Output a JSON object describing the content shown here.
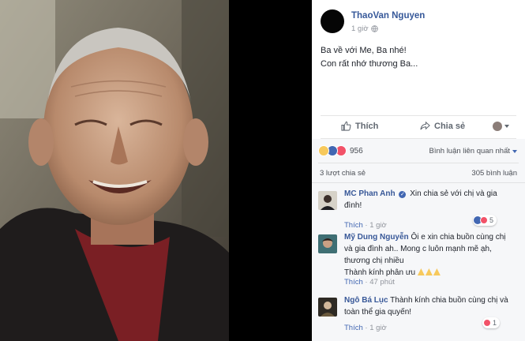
{
  "post": {
    "author": "ThaoVan Nguyen",
    "time": "1 giờ",
    "lines": [
      "Ba về với Me, Ba nhé!",
      "Con rất nhớ thương Ba..."
    ]
  },
  "actions": {
    "like": "Thích",
    "share": "Chia sẻ"
  },
  "summary": {
    "reaction_count": "956",
    "sort_label": "Bình luận liên quan nhất",
    "shares": "3 lượt chia sẻ",
    "comments": "305 bình luận"
  },
  "comments": [
    {
      "name": "MC Phan Anh",
      "verified": true,
      "text": "Xin chia sẻ với chị và gia đình!",
      "like": "Thích",
      "time": "1 giờ",
      "reactions": "5"
    },
    {
      "name": "Mỹ Dung Nguyễn",
      "text": "Ôi e xin chia buồn cùng chị và gia đình ah.. Mong c luôn mạnh mẽ ạh, thương chị nhiều",
      "text2": "Thành kính phân ưu",
      "like": "Thích",
      "time": "47 phút"
    },
    {
      "name": "Ngô Bá Lục",
      "text": "Thành kính chia buồn cùng chị và toàn thể gia quyến!",
      "like": "Thích",
      "time": "1 giờ",
      "reactions": "1"
    }
  ],
  "colors": {
    "link_blue": "#365899",
    "accent": "#4267b2",
    "muted": "#90949c",
    "viewer_bg": "#000000"
  },
  "icons": [
    "globe-icon",
    "like-icon",
    "share-icon",
    "caret-down-icon",
    "verified-icon"
  ]
}
